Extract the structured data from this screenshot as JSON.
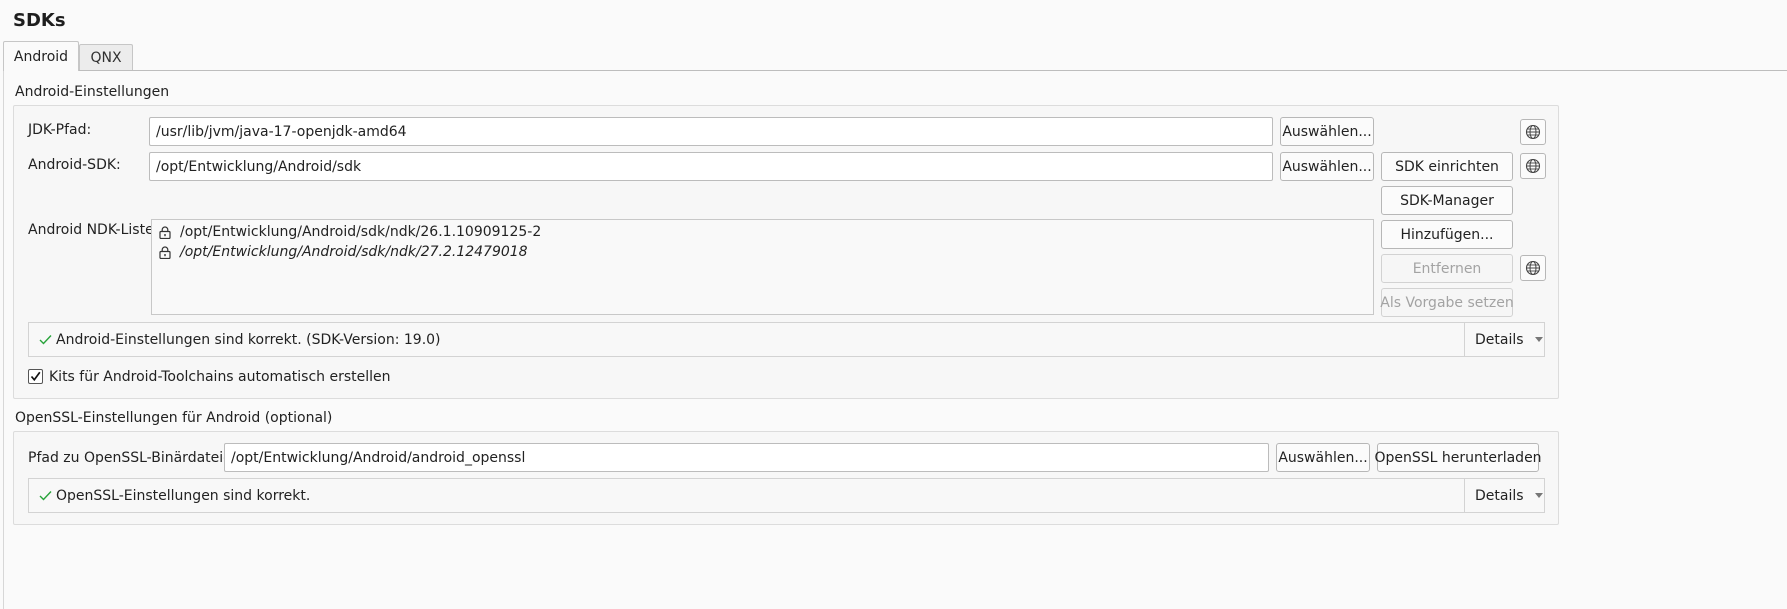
{
  "page": {
    "title": "SDKs"
  },
  "tabs": [
    {
      "label": "Android",
      "active": true
    },
    {
      "label": "QNX",
      "active": false
    }
  ],
  "android": {
    "section_title": "Android-Einstellungen",
    "jdk": {
      "label": "JDK-Pfad:",
      "value": "/usr/lib/jvm/java-17-openjdk-amd64",
      "browse": "Auswählen..."
    },
    "sdk": {
      "label": "Android-SDK:",
      "value": "/opt/Entwicklung/Android/sdk",
      "browse": "Auswählen...",
      "setup": "SDK einrichten"
    },
    "sdk_manager": "SDK-Manager",
    "ndk": {
      "label": "Android NDK-Liste:",
      "items": [
        {
          "path": "/opt/Entwicklung/Android/sdk/ndk/26.1.10909125-2",
          "italic": false
        },
        {
          "path": "/opt/Entwicklung/Android/sdk/ndk/27.2.12479018",
          "italic": true
        }
      ],
      "add": "Hinzufügen...",
      "remove": "Entfernen",
      "set_default": "Als Vorgabe setzen"
    },
    "status": {
      "text": "Android-Einstellungen sind korrekt. (SDK-Version: 19.0)",
      "details": "Details"
    },
    "auto_kits": {
      "label": "Kits für Android-Toolchains automatisch erstellen",
      "checked": true
    }
  },
  "openssl": {
    "section_title": "OpenSSL-Einstellungen für Android (optional)",
    "path": {
      "label": "Pfad zu OpenSSL-Binärdateien:",
      "value": "/opt/Entwicklung/Android/android_openssl",
      "browse": "Auswählen...",
      "download": "OpenSSL herunterladen"
    },
    "status": {
      "text": "OpenSSL-Einstellungen sind korrekt.",
      "details": "Details"
    }
  },
  "icons": {
    "globe": "globe-icon",
    "lock": "lock-icon",
    "check": "check-icon",
    "dropdown": "chevron-down-icon"
  },
  "colors": {
    "ok": "#27a33a",
    "disabled_text": "#a3a3a3"
  }
}
